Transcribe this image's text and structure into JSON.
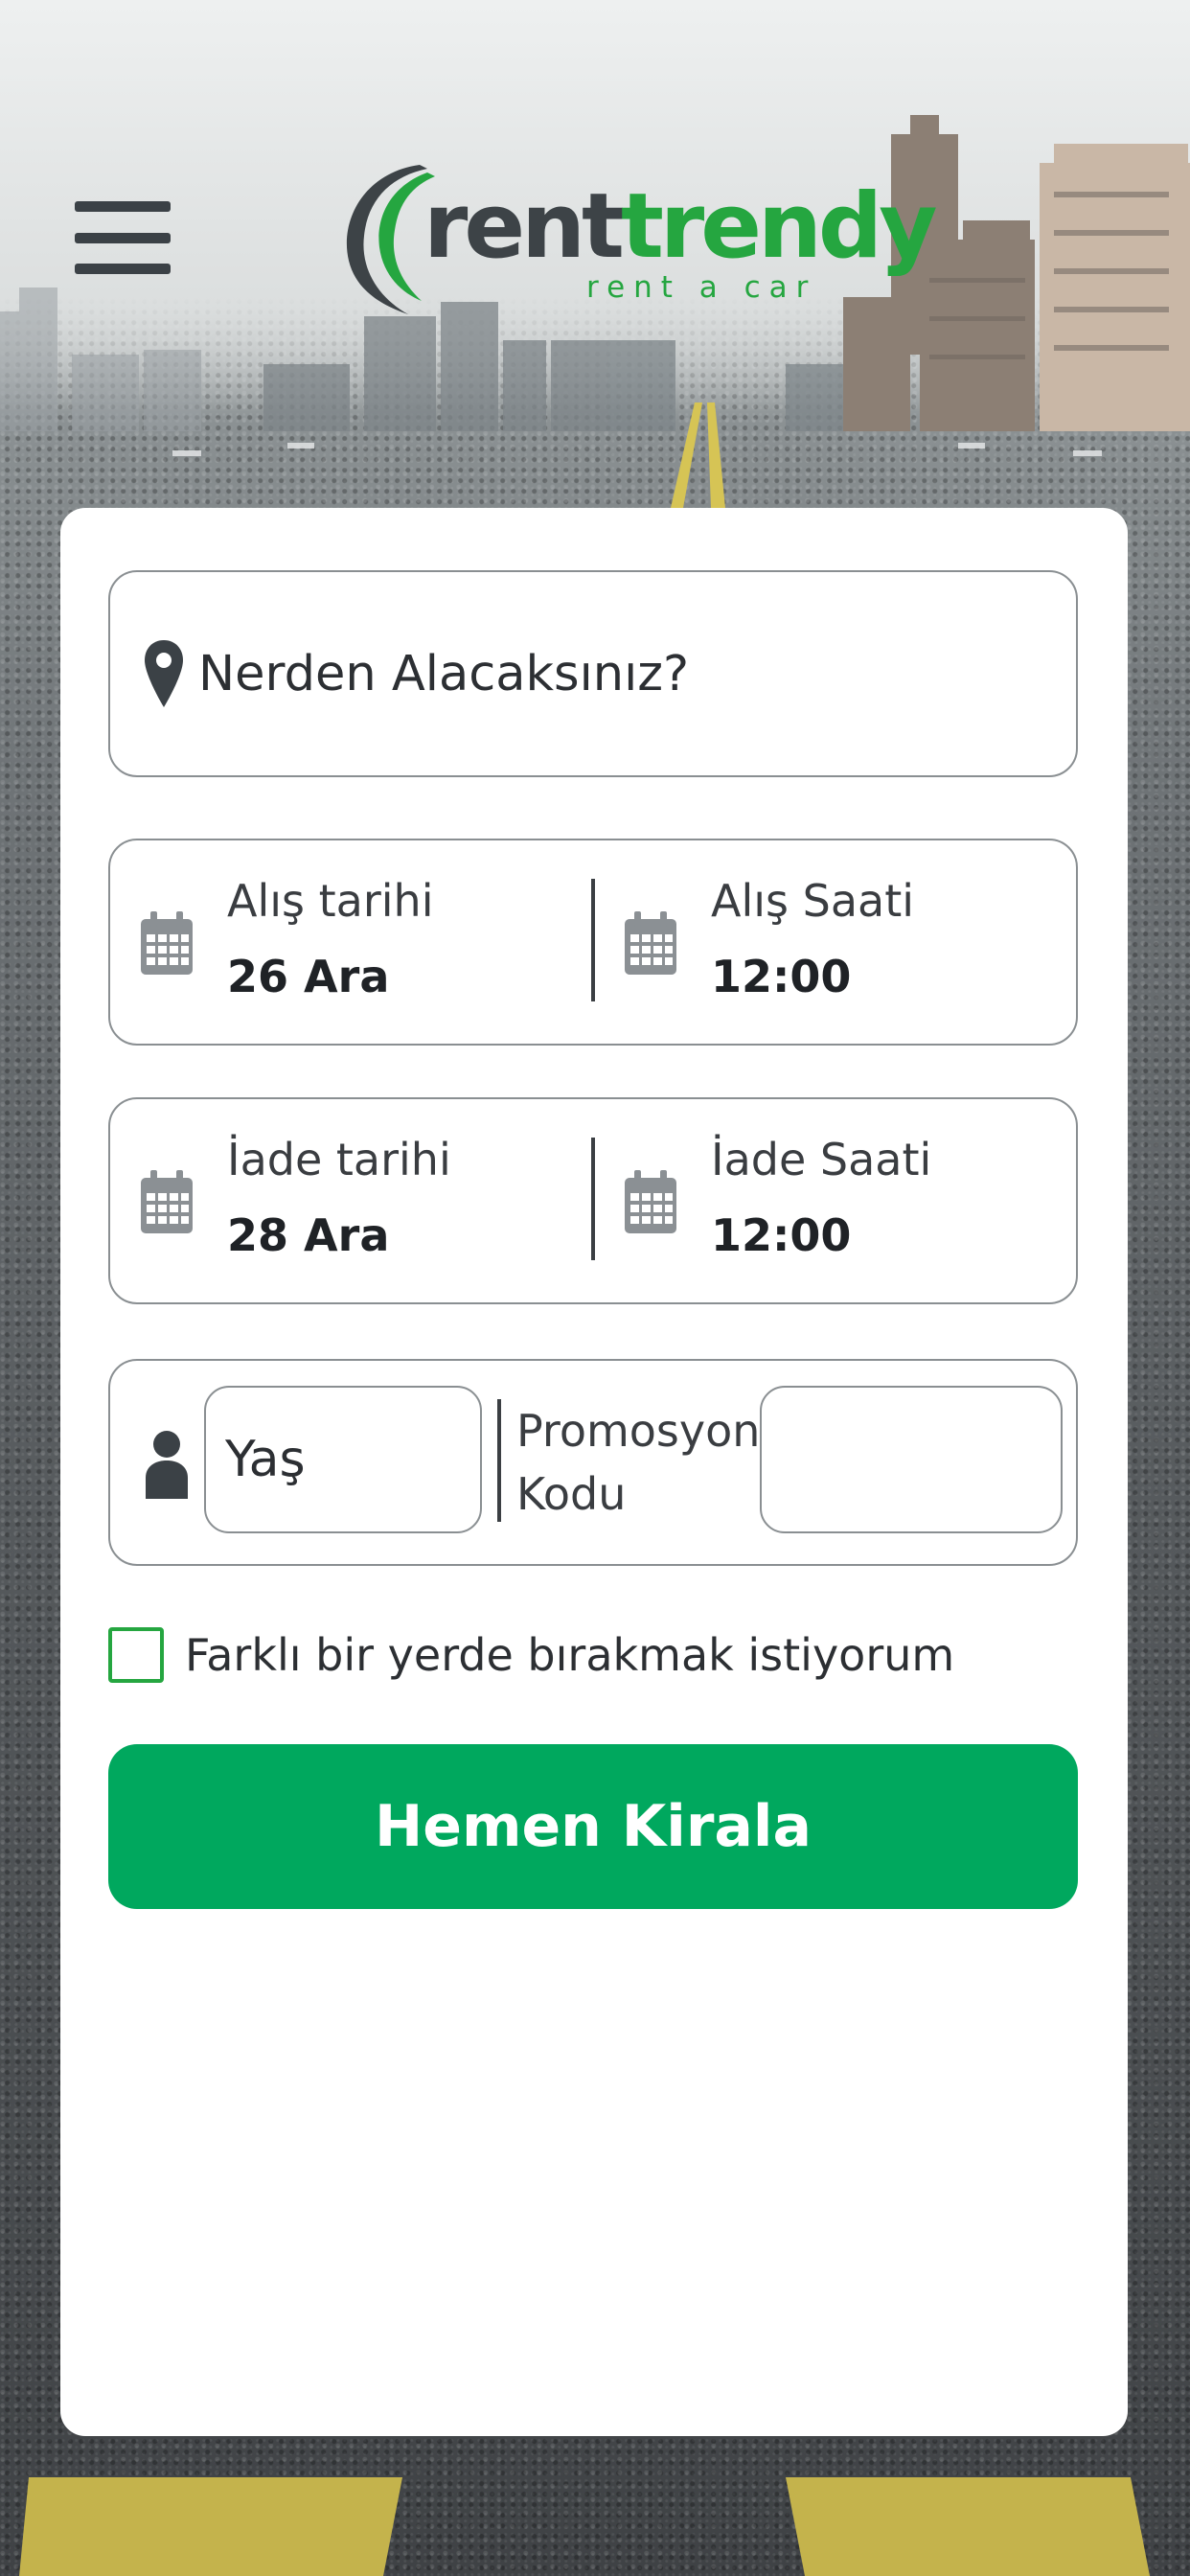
{
  "header": {
    "menu_icon": "hamburger-menu-icon",
    "logo": {
      "word_rent": "rent",
      "word_trendy": "trendy",
      "tagline": "rent a car"
    }
  },
  "form": {
    "location": {
      "icon": "map-pin-icon",
      "placeholder": "Nerden Alacaksınız?"
    },
    "pickup": {
      "date_label": "Alış tarihi",
      "date_value": "26 Ara",
      "time_label": "Alış Saati",
      "time_value": "12:00"
    },
    "return": {
      "date_label": "İade tarihi",
      "date_value": "28 Ara",
      "time_label": "İade Saati",
      "time_value": "12:00"
    },
    "age": {
      "icon": "person-icon",
      "placeholder": "Yaş",
      "value": ""
    },
    "promo": {
      "label_line1": "Promosyon",
      "label_line2": "Kodu",
      "value": ""
    },
    "different_dropoff": {
      "label": "Farklı bir yerde bırakmak istiyorum",
      "checked": false
    },
    "submit_label": "Hemen Kirala"
  },
  "colors": {
    "brand_green": "#25a640",
    "button_green": "#00a85e",
    "logo_dark": "#3d4347"
  }
}
